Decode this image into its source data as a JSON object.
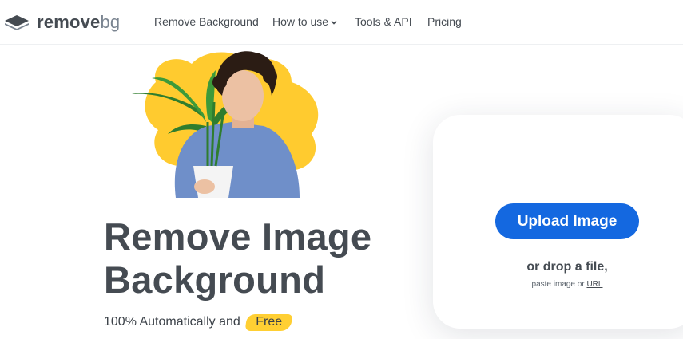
{
  "logo": {
    "text_main": "remove",
    "text_accent": "bg"
  },
  "nav": [
    {
      "label": "Remove Background"
    },
    {
      "label": "How to use",
      "has_dropdown": true
    },
    {
      "label": "Tools & API"
    },
    {
      "label": "Pricing"
    }
  ],
  "hero": {
    "title_line1": "Remove Image",
    "title_line2": "Background",
    "subtitle_prefix": "100% Automatically and",
    "subtitle_highlight": "Free"
  },
  "upload": {
    "button_label": "Upload Image",
    "drop_text": "or drop a file,",
    "paste_prefix": "paste image or",
    "url_link": "URL"
  },
  "colors": {
    "accent_blue": "#1468e0",
    "highlight_yellow": "#ffcf33",
    "text_dark": "#454b52"
  }
}
